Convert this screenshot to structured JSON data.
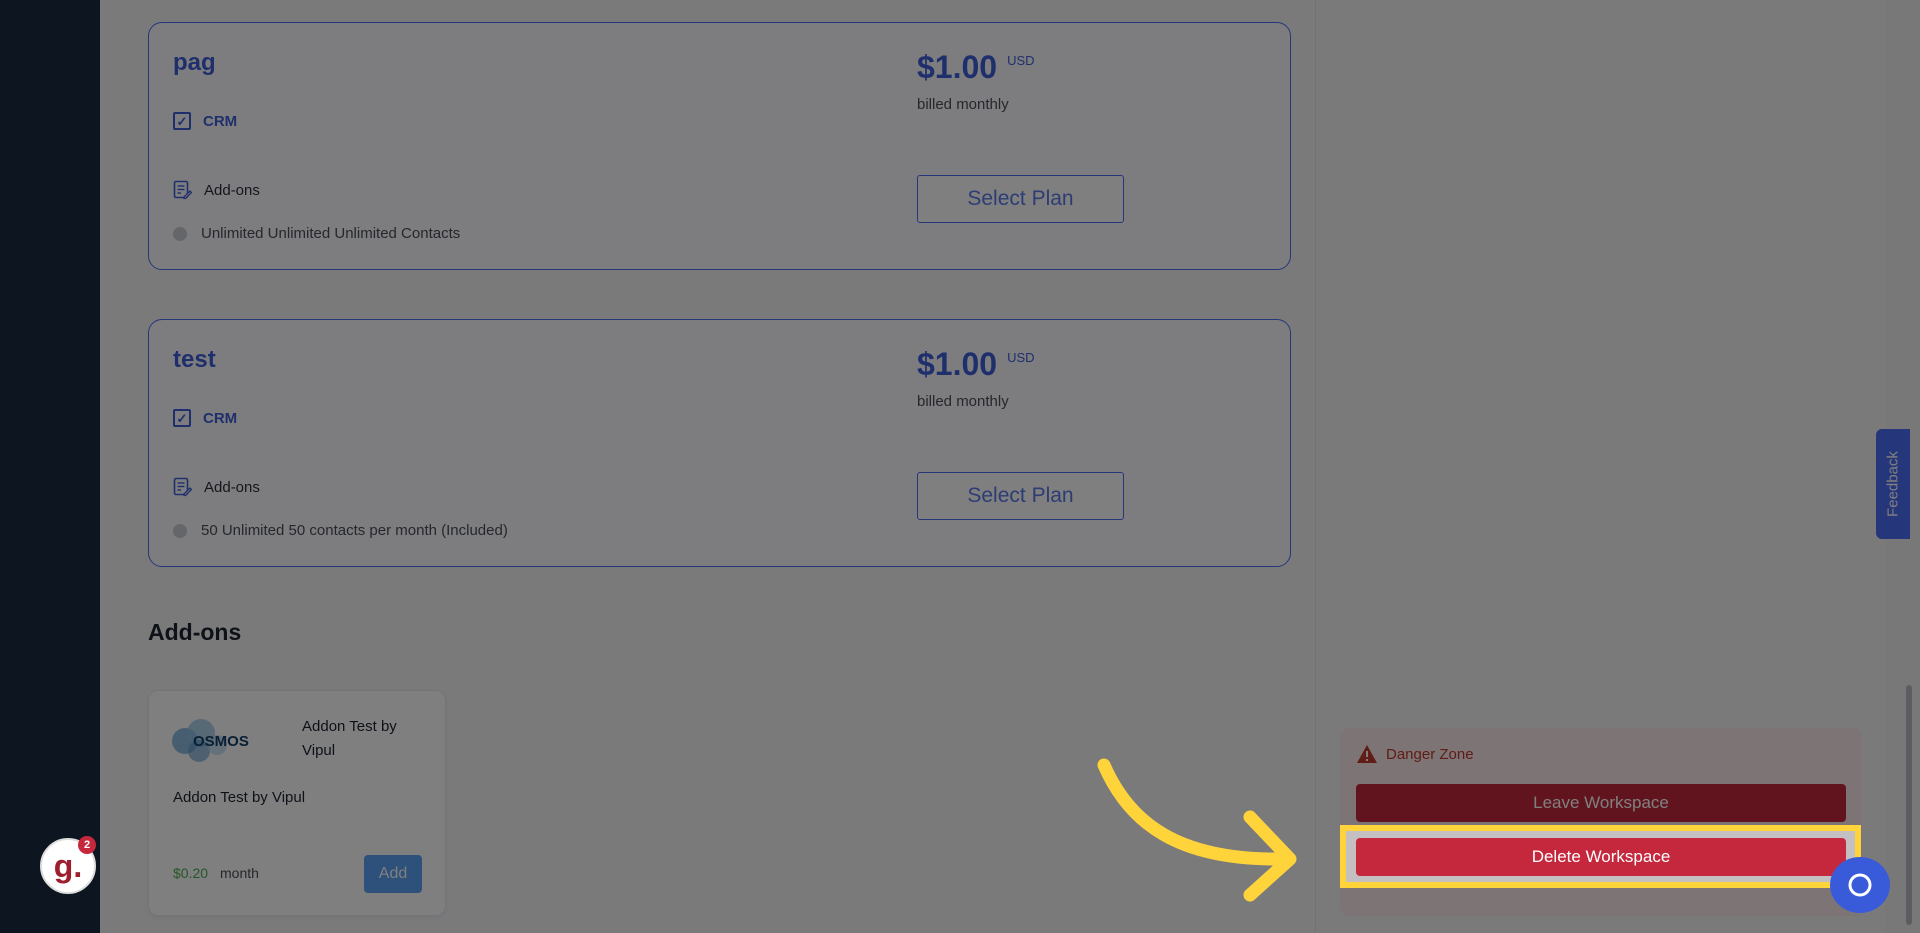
{
  "plans": [
    {
      "name": "pag",
      "feature": "CRM",
      "addons_label": "Add-ons",
      "limit": "Unlimited Unlimited Unlimited Contacts",
      "price": "$1.00",
      "currency": "USD",
      "billing": "billed monthly",
      "cta": "Select Plan"
    },
    {
      "name": "test",
      "feature": "CRM",
      "addons_label": "Add-ons",
      "limit": "50 Unlimited 50 contacts per month (Included)",
      "price": "$1.00",
      "currency": "USD",
      "billing": "billed monthly",
      "cta": "Select Plan"
    }
  ],
  "addons_section": {
    "title": "Add-ons",
    "items": [
      {
        "logo_text": "OSMOS",
        "name": "Addon Test by Vipul",
        "description": "Addon Test by Vipul",
        "price": "$0.20",
        "period": "month",
        "cta": "Add"
      }
    ]
  },
  "danger_zone": {
    "title": "Danger Zone",
    "leave_label": "Leave Workspace",
    "delete_label": "Delete Workspace"
  },
  "feedback": {
    "label": "Feedback"
  },
  "guide_badge": {
    "letter": "g.",
    "count": "2"
  },
  "colors": {
    "accent": "#3e5fd8",
    "danger": "#c5283d",
    "highlight": "#ffd43b",
    "sidebar": "#1b2a41"
  }
}
